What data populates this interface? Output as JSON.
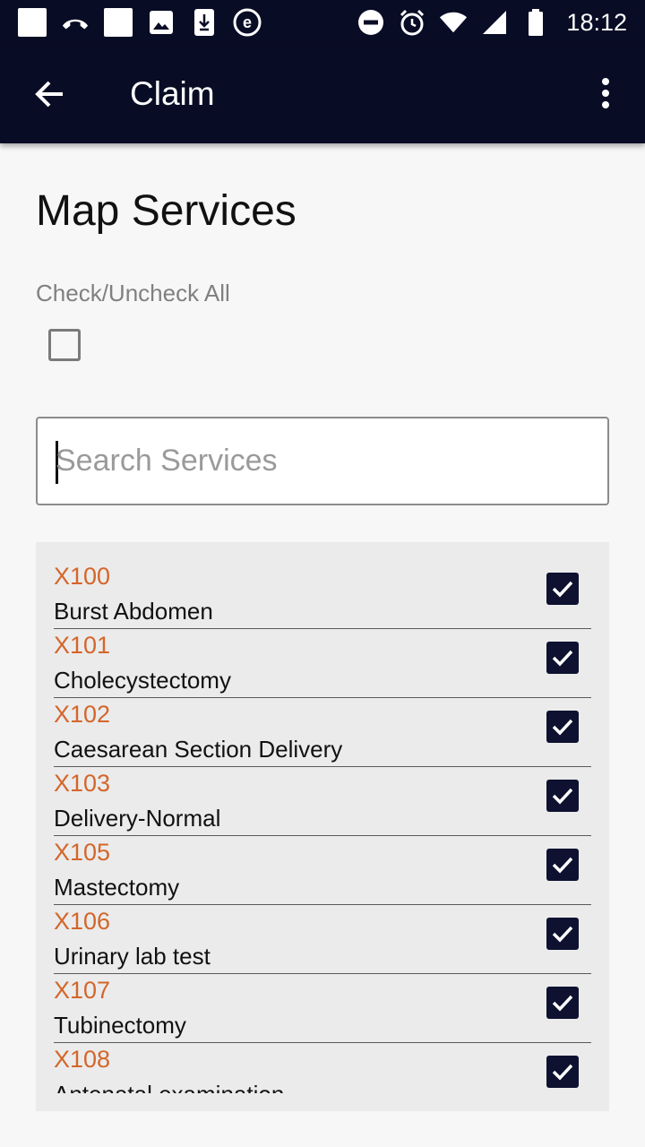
{
  "status_bar": {
    "time": "18:12",
    "left_icons": [
      "notification-square-icon",
      "missed-call-icon",
      "notification-square-icon",
      "image-icon",
      "download-icon",
      "e-app-icon"
    ],
    "right_icons": [
      "do-not-disturb-icon",
      "alarm-icon",
      "wifi-icon",
      "cell-signal-icon",
      "battery-icon"
    ]
  },
  "app_bar": {
    "title": "Claim",
    "back_icon": "arrow-back-icon",
    "menu_icon": "more-vert-icon"
  },
  "page": {
    "title": "Map Services",
    "check_all_label": "Check/Uncheck All",
    "check_all_checked": false
  },
  "search": {
    "placeholder": "Search Services",
    "value": ""
  },
  "colors": {
    "bar_background": "#090c25",
    "service_code": "#d4662a",
    "checkbox_checked": "#0e1230",
    "list_background": "#ebebeb"
  },
  "services": [
    {
      "code": "X100",
      "name": "Burst Abdomen",
      "checked": true
    },
    {
      "code": "X101",
      "name": "Cholecystectomy",
      "checked": true
    },
    {
      "code": "X102",
      "name": "Caesarean Section Delivery",
      "checked": true
    },
    {
      "code": "X103",
      "name": "Delivery-Normal",
      "checked": true
    },
    {
      "code": "X105",
      "name": "Mastectomy",
      "checked": true
    },
    {
      "code": "X106",
      "name": "Urinary lab test",
      "checked": true
    },
    {
      "code": "X107",
      "name": "Tubinectomy",
      "checked": true
    },
    {
      "code": "X108",
      "name": "Antenatal examination",
      "checked": true
    }
  ]
}
